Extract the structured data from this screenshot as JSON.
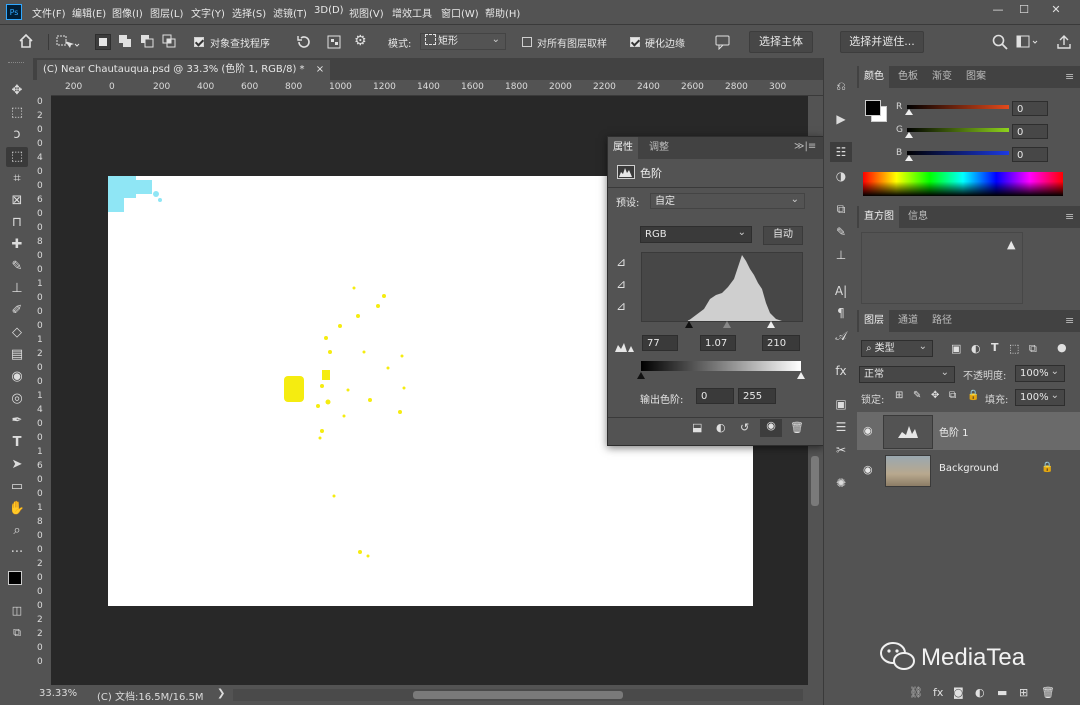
{
  "app": {
    "logo": "Ps"
  },
  "menu": [
    "文件(F)",
    "编辑(E)",
    "图像(I)",
    "图层(L)",
    "文字(Y)",
    "选择(S)",
    "滤镜(T)",
    "3D(D)",
    "视图(V)",
    "增效工具",
    "窗口(W)",
    "帮助(H)"
  ],
  "window_controls": {
    "minimize": "—",
    "maximize": "☐",
    "close": "✕"
  },
  "options_bar": {
    "object_finder_label": "对象查找程序",
    "mode_label": "模式:",
    "mode_value": "矩形",
    "sample_all_label": "对所有图层取样",
    "harden_edges_label": "硬化边缘",
    "select_subject_label": "选择主体",
    "select_and_mask_label": "选择并遮住..."
  },
  "document": {
    "tab_title": "(C) Near Chautauqua.psd @ 33.3% (色阶 1, RGB/8) *",
    "close": "×"
  },
  "ruler": {
    "h_labels": [
      "200",
      "0",
      "200",
      "400",
      "600",
      "800",
      "1000",
      "1200",
      "1400",
      "1600",
      "1800",
      "2000",
      "2200",
      "2400",
      "2600",
      "2800",
      "300"
    ],
    "v_labels": [
      "0",
      "2",
      "0",
      "0",
      "4",
      "0",
      "0",
      "6",
      "0",
      "0",
      "8",
      "0",
      "0",
      "1",
      "0",
      "0",
      "0",
      "1",
      "2",
      "0",
      "0",
      "1",
      "4",
      "0",
      "0",
      "1",
      "6",
      "0",
      "0",
      "1",
      "8",
      "0",
      "0",
      "2",
      "0",
      "0",
      "0",
      "2",
      "2",
      "0",
      "0"
    ]
  },
  "status": {
    "zoom": "33.33%",
    "doc_info": "(C) 文档:16.5M/16.5M",
    "arrow": "❯"
  },
  "properties": {
    "tabs": [
      "属性",
      "调整"
    ],
    "panel_title": "色阶",
    "preset_label": "预设:",
    "preset_value": "自定",
    "channel_value": "RGB",
    "auto_label": "自动",
    "input_black": "77",
    "input_gamma": "1.07",
    "input_white": "210",
    "output_label": "输出色阶:",
    "output_black": "0",
    "output_white": "255"
  },
  "color_panel": {
    "tabs": [
      "颜色",
      "色板",
      "渐变",
      "图案"
    ],
    "channels": [
      {
        "label": "R",
        "value": "0",
        "color": "#e34a1c"
      },
      {
        "label": "G",
        "value": "0",
        "color": "#8ed41c"
      },
      {
        "label": "B",
        "value": "0",
        "color": "#1c3ae3"
      }
    ]
  },
  "histogram_panel": {
    "tabs": [
      "直方图",
      "信息"
    ],
    "warning": "▲"
  },
  "layers_panel": {
    "tabs": [
      "图层",
      "通道",
      "路径"
    ],
    "filter_value": "类型",
    "blend_mode": "正常",
    "opacity_label": "不透明度:",
    "opacity_value": "100%",
    "lock_label": "锁定:",
    "fill_label": "填充:",
    "fill_value": "100%",
    "layers": [
      {
        "name": "色阶 1",
        "selected": true
      },
      {
        "name": "Background",
        "selected": false
      }
    ]
  },
  "watermark": {
    "text": "MediaTea"
  },
  "colors": {
    "chrome": "#535353",
    "dark": "#282828",
    "accent_blue": "#31a8ff"
  }
}
